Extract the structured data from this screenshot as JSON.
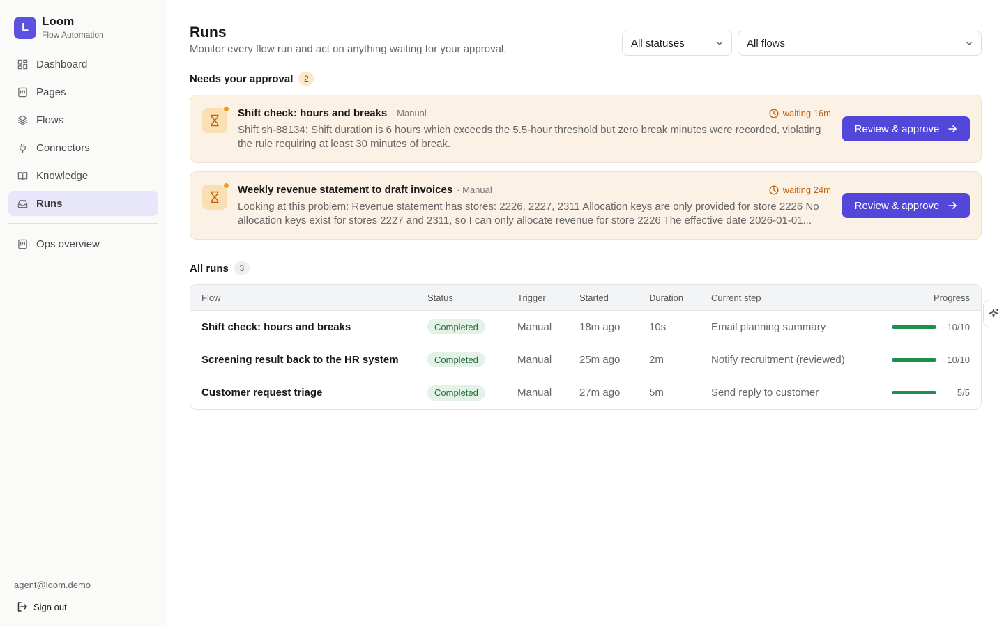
{
  "brand": {
    "logo_letter": "L",
    "name": "Loom",
    "subtitle": "Flow Automation"
  },
  "sidebar": {
    "items": [
      {
        "label": "Dashboard",
        "icon": "dashboard-icon",
        "active": false
      },
      {
        "label": "Pages",
        "icon": "pages-icon",
        "active": false
      },
      {
        "label": "Flows",
        "icon": "layers-icon",
        "active": false
      },
      {
        "label": "Connectors",
        "icon": "plug-icon",
        "active": false
      },
      {
        "label": "Knowledge",
        "icon": "book-icon",
        "active": false
      },
      {
        "label": "Runs",
        "icon": "inbox-icon",
        "active": true
      }
    ],
    "secondary": [
      {
        "label": "Ops overview",
        "icon": "pages-icon"
      }
    ],
    "user_email": "agent@loom.demo",
    "sign_out": "Sign out"
  },
  "header": {
    "title": "Runs",
    "subtitle": "Monitor every flow run and act on anything waiting for your approval.",
    "status_filter": "All statuses",
    "flow_filter": "All flows"
  },
  "approval": {
    "heading": "Needs your approval",
    "count": "2",
    "cards": [
      {
        "title": "Shift check: hours and breaks",
        "trigger": "· Manual",
        "waiting": "waiting 16m",
        "description": "Shift sh-88134: Shift duration is 6 hours which exceeds the 5.5-hour threshold but zero break minutes were recorded, violating the rule requiring at least 30 minutes of break.",
        "button": "Review & approve"
      },
      {
        "title": "Weekly revenue statement to draft invoices",
        "trigger": "· Manual",
        "waiting": "waiting 24m",
        "description": "Looking at this problem: Revenue statement has stores: 2226, 2227, 2311 Allocation keys are only provided for store 2226 No allocation keys exist for stores 2227 and 2311, so I can only allocate revenue for store 2226 The effective date 2026-01-01...",
        "button": "Review & approve"
      }
    ]
  },
  "runs": {
    "heading": "All runs",
    "count": "3",
    "columns": [
      "Flow",
      "Status",
      "Trigger",
      "Started",
      "Duration",
      "Current step",
      "Progress"
    ],
    "rows": [
      {
        "flow": "Shift check: hours and breaks",
        "status": "Completed",
        "trigger": "Manual",
        "started": "18m ago",
        "duration": "10s",
        "step": "Email planning summary",
        "progress": "10/10",
        "progress_fraction": 1.0
      },
      {
        "flow": "Screening result back to the HR system",
        "status": "Completed",
        "trigger": "Manual",
        "started": "25m ago",
        "duration": "2m",
        "step": "Notify recruitment (reviewed)",
        "progress": "10/10",
        "progress_fraction": 1.0
      },
      {
        "flow": "Customer request triage",
        "status": "Completed",
        "trigger": "Manual",
        "started": "27m ago",
        "duration": "5m",
        "step": "Send reply to customer",
        "progress": "5/5",
        "progress_fraction": 1.0
      }
    ]
  },
  "colors": {
    "accent": "#5347d9",
    "success": "#1e8e4e",
    "warning": "#c2630d"
  }
}
